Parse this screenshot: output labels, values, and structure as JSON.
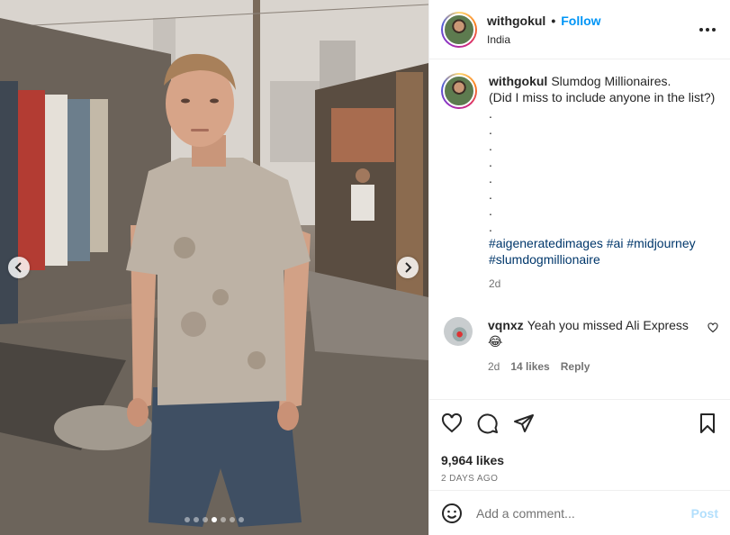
{
  "image": {
    "alt_subject": "photo-slum-portrait"
  },
  "carousel": {
    "slide_count": 7,
    "active_index": 3
  },
  "header": {
    "username": "withgokul",
    "separator": "•",
    "follow_label": "Follow",
    "location": "India"
  },
  "caption": {
    "username": "withgokul",
    "text": "Slumdog Millionaires.",
    "text2": "(Did I miss to include anyone in the list?)",
    "dots": [
      ".",
      ".",
      ".",
      ".",
      ".",
      ".",
      ".",
      "."
    ],
    "tags": [
      "#aigeneratedimages",
      "#ai",
      "#midjourney",
      "#slumdogmillionaire"
    ],
    "time": "2d"
  },
  "comment": {
    "username": "vqnxz",
    "text": "Yeah you missed Ali Express",
    "emoji": "😂",
    "time": "2d",
    "likes": "14 likes",
    "reply_label": "Reply"
  },
  "stats": {
    "likes": "9,964 likes",
    "date": "2 DAYS AGO"
  },
  "composer": {
    "placeholder": "Add a comment...",
    "post_label": "Post"
  },
  "colors": {
    "accent": "#0095f6",
    "post_disabled": "#b2dffc",
    "hashtag": "#00376b",
    "muted": "#737373"
  },
  "icons": [
    "more-icon",
    "heart-icon",
    "comment-icon",
    "share-icon",
    "bookmark-icon",
    "emoji-icon",
    "chevron-left-icon",
    "chevron-right-icon"
  ]
}
